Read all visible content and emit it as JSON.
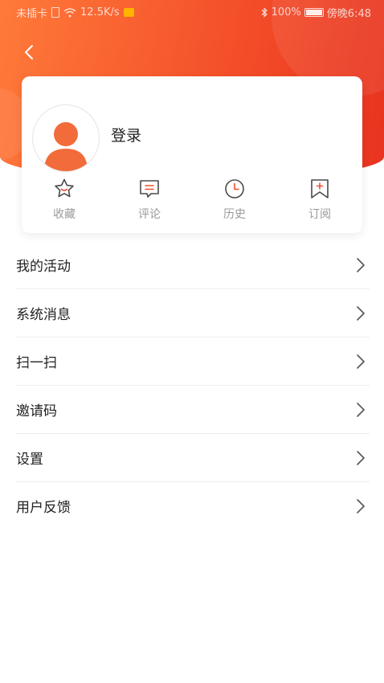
{
  "status_bar": {
    "carrier": "未插卡",
    "network_speed": "12.5K/s",
    "battery_percent": "100%",
    "time": "傍晚6:48"
  },
  "header": {
    "back_icon": "chevron-left-icon",
    "gradient_colors": [
      "#ff7a3a",
      "#f4512a",
      "#e8331f"
    ]
  },
  "profile": {
    "login_label": "登录",
    "avatar_color": "#f26b3a",
    "quick_actions": [
      {
        "label": "收藏",
        "icon": "star-icon"
      },
      {
        "label": "评论",
        "icon": "comment-icon"
      },
      {
        "label": "历史",
        "icon": "clock-icon"
      },
      {
        "label": "订阅",
        "icon": "bookmark-plus-icon"
      }
    ]
  },
  "menu": {
    "items": [
      {
        "label": "我的活动"
      },
      {
        "label": "系统消息"
      },
      {
        "label": "扫一扫"
      },
      {
        "label": "邀请码"
      },
      {
        "label": "设置"
      },
      {
        "label": "用户反馈"
      }
    ]
  },
  "colors": {
    "accent": "#f04e2a",
    "text_primary": "#222222",
    "text_secondary": "#9a9a9a"
  }
}
